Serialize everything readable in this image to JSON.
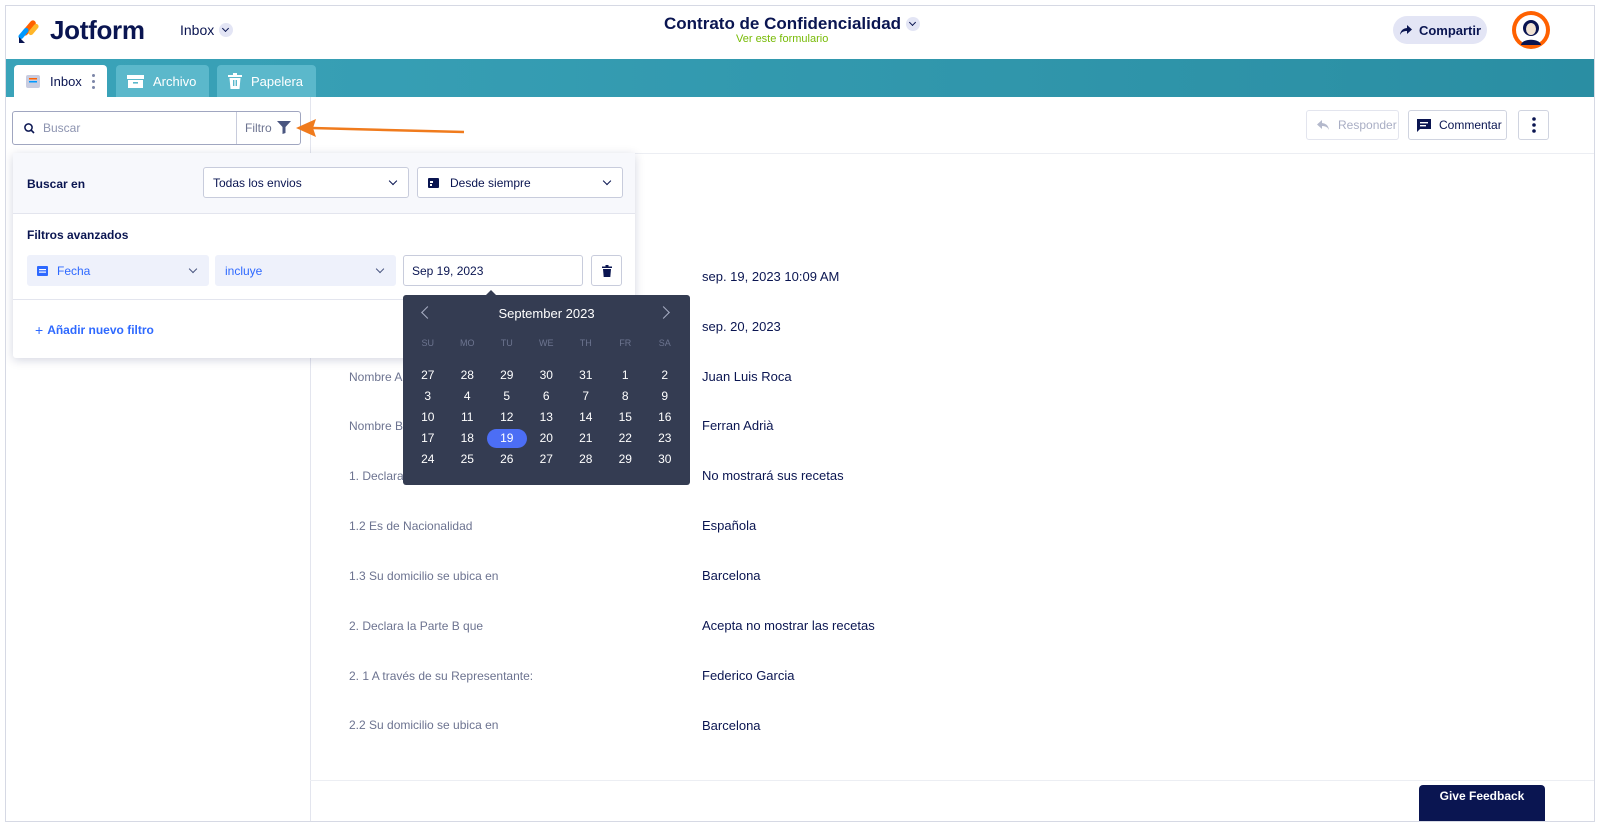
{
  "app": {
    "brand": "Jotform",
    "inbox_switch": "Inbox",
    "form_title": "Contrato de Confidencialidad",
    "form_subtitle": "Ver este formulario",
    "share_label": "Compartir"
  },
  "tabs": [
    {
      "label": "Inbox"
    },
    {
      "label": "Archivo"
    },
    {
      "label": "Papelera"
    }
  ],
  "search": {
    "placeholder": "Buscar",
    "filter_label": "Filtro"
  },
  "filter_panel": {
    "search_in_label": "Buscar en",
    "scope_value": "Todas los envios",
    "range_value": "Desde siempre",
    "advanced_label": "Filtros avanzados",
    "field_value": "Fecha",
    "operator_value": "incluye",
    "date_value": "Sep 19, 2023",
    "add_filter_label": "Añadir nuevo filtro"
  },
  "calendar": {
    "month_label": "September 2023",
    "weekdays": [
      "SU",
      "MO",
      "TU",
      "WE",
      "TH",
      "FR",
      "SA"
    ],
    "weeks": [
      [
        "27",
        "28",
        "29",
        "30",
        "31",
        "1",
        "2"
      ],
      [
        "3",
        "4",
        "5",
        "6",
        "7",
        "8",
        "9"
      ],
      [
        "10",
        "11",
        "12",
        "13",
        "14",
        "15",
        "16"
      ],
      [
        "17",
        "18",
        "19",
        "20",
        "21",
        "22",
        "23"
      ],
      [
        "24",
        "25",
        "26",
        "27",
        "28",
        "29",
        "30"
      ]
    ],
    "selected_day": "19"
  },
  "toolbar": {
    "reply_label": "Responder",
    "comment_label": "Commentar"
  },
  "submission": {
    "rows": [
      {
        "label": "",
        "value": "sep. 19, 2023 10:09 AM"
      },
      {
        "label": "",
        "value": "sep. 20, 2023"
      },
      {
        "label": "Nombre A",
        "value": "Juan Luis Roca"
      },
      {
        "label": "Nombre B",
        "value": "Ferran Adrià"
      },
      {
        "label": "1. Declara",
        "value": "No mostrará sus recetas"
      },
      {
        "label": "1.2 Es de Nacionalidad",
        "value": "Española"
      },
      {
        "label": "1.3 Su domicilio se ubica en",
        "value": "Barcelona"
      },
      {
        "label": "2. Declara la Parte B que",
        "value": "Acepta no mostrar las recetas"
      },
      {
        "label": "2. 1 A través de su Representante:",
        "value": "Federico Garcia"
      },
      {
        "label": "2.2 Su domicilio se ubica en",
        "value": "Barcelona"
      }
    ]
  },
  "feedback_label": "Give Feedback",
  "colors": {
    "navy": "#0a1551",
    "teal": "#3aa3b9",
    "accent_blue": "#2e69ff",
    "orange": "#ff6100",
    "green": "#78bb07",
    "calendar_bg": "#343c52"
  }
}
